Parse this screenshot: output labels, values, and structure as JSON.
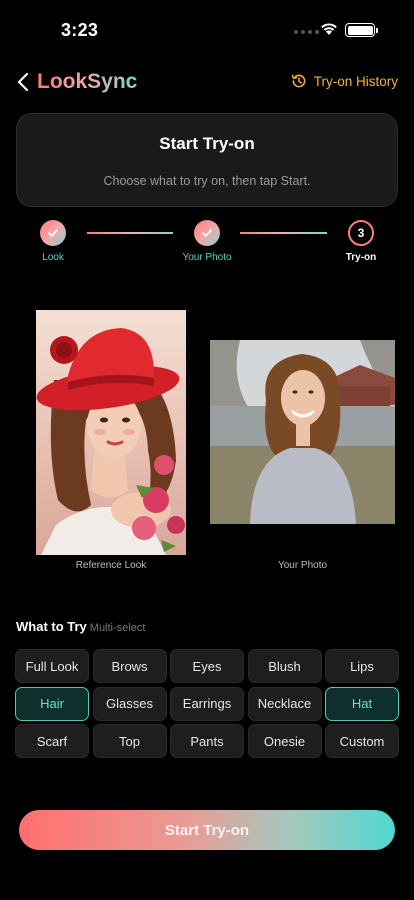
{
  "status_bar": {
    "time": "3:23"
  },
  "header": {
    "app_title": "LookSync",
    "history_label": "Try-on History"
  },
  "card": {
    "title": "Start Try-on",
    "subtitle": "Choose what to try on, then tap Start."
  },
  "steps": [
    {
      "label": "Look",
      "state": "done"
    },
    {
      "label": "Your Photo",
      "state": "done"
    },
    {
      "label": "Try-on",
      "state": "current",
      "number": "3"
    }
  ],
  "photos": {
    "reference_caption": "Reference Look",
    "user_caption": "Your Photo"
  },
  "what_to_try": {
    "title": "What to Try",
    "hint": "Multi-select",
    "options": [
      {
        "label": "Full Look",
        "selected": false
      },
      {
        "label": "Brows",
        "selected": false
      },
      {
        "label": "Eyes",
        "selected": false
      },
      {
        "label": "Blush",
        "selected": false
      },
      {
        "label": "Lips",
        "selected": false
      },
      {
        "label": "Hair",
        "selected": true
      },
      {
        "label": "Glasses",
        "selected": false
      },
      {
        "label": "Earrings",
        "selected": false
      },
      {
        "label": "Necklace",
        "selected": false
      },
      {
        "label": "Hat",
        "selected": true
      },
      {
        "label": "Scarf",
        "selected": false
      },
      {
        "label": "Top",
        "selected": false
      },
      {
        "label": "Pants",
        "selected": false
      },
      {
        "label": "Onesie",
        "selected": false
      },
      {
        "label": "Custom",
        "selected": false
      }
    ]
  },
  "cta": {
    "label": "Start Try-on"
  },
  "colors": {
    "accent_coral": "#ff7b7b",
    "accent_teal": "#5fd0c4",
    "history_gold": "#f2b23a"
  }
}
